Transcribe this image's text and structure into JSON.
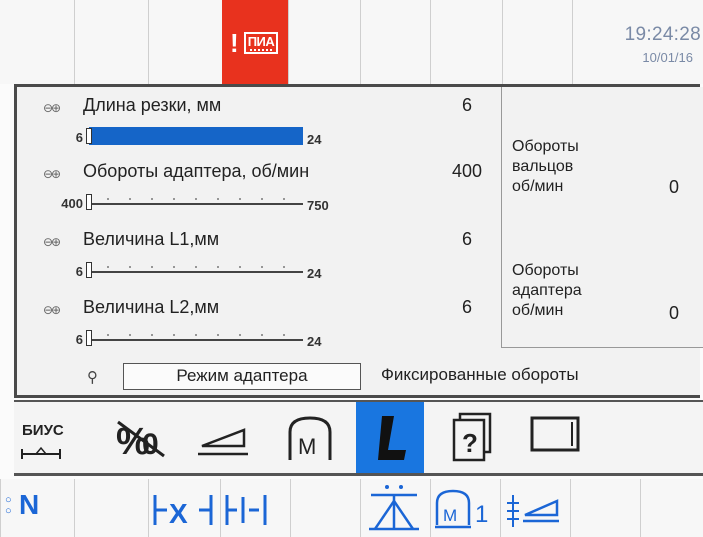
{
  "status_bar": {
    "alarm_icon": "alarm-warning-icon",
    "alarm_label": "ПИА",
    "time": "19:24:28",
    "date": "10/01/16"
  },
  "parameters": [
    {
      "label": "Длина резки, мм",
      "value": "6",
      "min": "6",
      "max": "24",
      "fill_fraction": 1.0
    },
    {
      "label": "Обороты адаптера, об/мин",
      "value": "400",
      "min": "400",
      "max": "750",
      "fill_fraction": 0.0
    },
    {
      "label": "Величина L1,мм",
      "value": "6",
      "min": "6",
      "max": "24",
      "fill_fraction": 0.0
    },
    {
      "label": "Величина L2,мм",
      "value": "6",
      "min": "6",
      "max": "24",
      "fill_fraction": 0.0
    }
  ],
  "readouts": [
    {
      "label": "Обороты\nвальцов\nоб/мин",
      "value": "0"
    },
    {
      "label": "Обороты\nадаптера\nоб/мин",
      "value": "0"
    }
  ],
  "mode": {
    "button_label": "Режим адаптера",
    "status": "Фиксированные обороты"
  },
  "toolbar": {
    "biys_label": "БИУС",
    "icons": [
      "biys-icon",
      "no-counter-icon",
      "wedge-icon",
      "header-m-icon",
      "knife-icon",
      "help-book-icon",
      "screen-icon"
    ],
    "active_index": 4,
    "active_color": "#1976e0"
  },
  "bottom_bar": {
    "icons": [
      "neutral-n-icon",
      "reverse-feed-icon",
      "forward-feed-icon",
      "lift-icon",
      "header-m1-icon",
      "wedge-adjust-icon"
    ],
    "n_label": "N",
    "m1_sub": "1"
  },
  "colors": {
    "accent_blue": "#1b66d6",
    "alarm_red": "#e8321e",
    "clock_gray": "#7a8aa6"
  }
}
